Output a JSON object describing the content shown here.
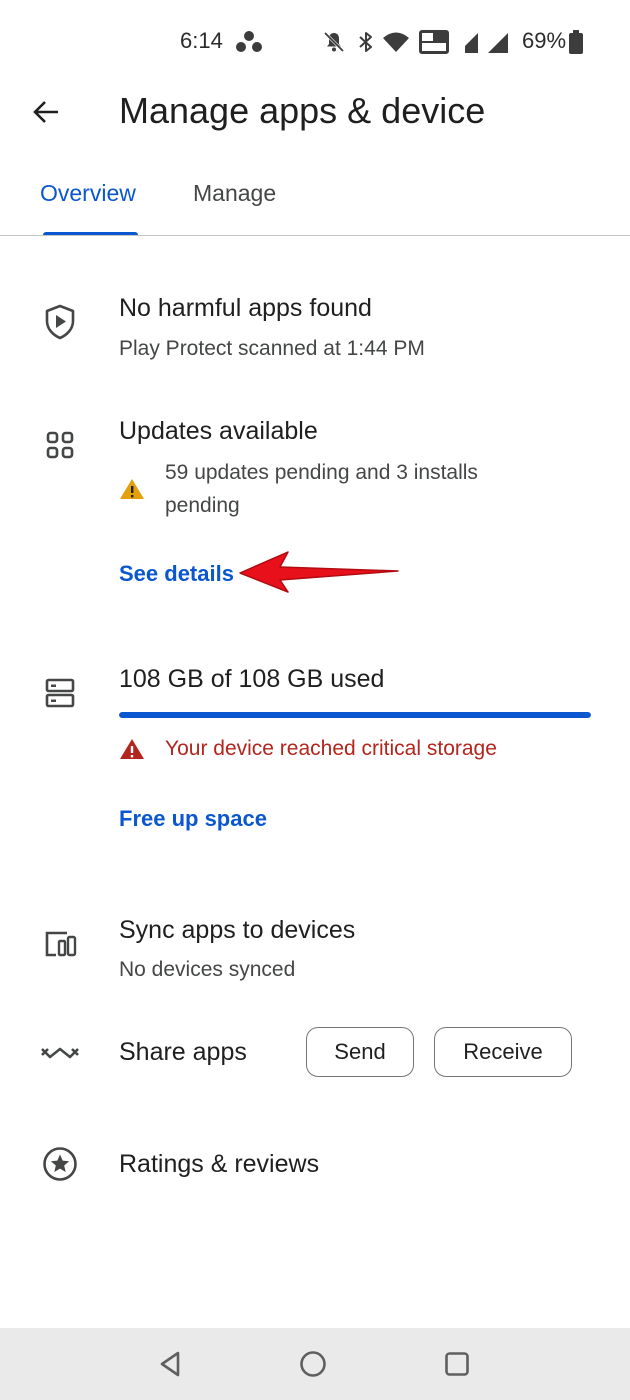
{
  "status_bar": {
    "time": "6:14",
    "battery_percent": "69%"
  },
  "app_bar": {
    "title": "Manage apps & device"
  },
  "tabs": [
    {
      "label": "Overview",
      "active": true
    },
    {
      "label": "Manage",
      "active": false
    }
  ],
  "protect": {
    "title": "No harmful apps found",
    "subtitle": "Play Protect scanned at 1:44 PM"
  },
  "updates": {
    "title": "Updates available",
    "warning_line1": "59 updates pending and 3 installs",
    "warning_line2": "pending",
    "link": "See details"
  },
  "storage": {
    "title": "108 GB of 108 GB used",
    "used_fraction": 1.0,
    "critical_message": "Your device reached critical storage",
    "link": "Free up space"
  },
  "sync": {
    "title": "Sync apps to devices",
    "subtitle": "No devices synced"
  },
  "share": {
    "title": "Share apps",
    "send_label": "Send",
    "receive_label": "Receive"
  },
  "ratings": {
    "title": "Ratings & reviews"
  },
  "colors": {
    "accent": "#0b57d0",
    "warning": "#e3a008",
    "critical": "#b3261e",
    "annotation_arrow": "#e8101a"
  }
}
